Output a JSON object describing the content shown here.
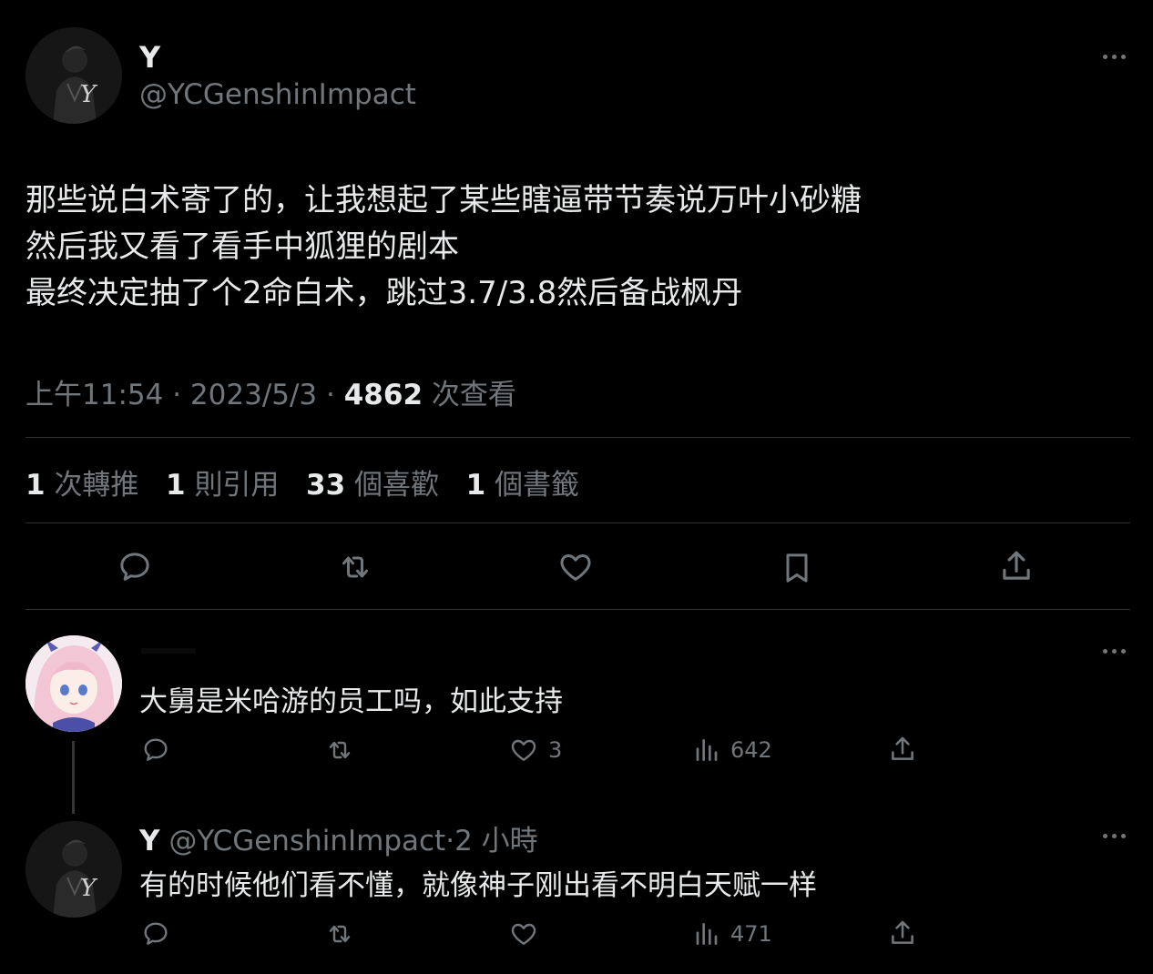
{
  "main_tweet": {
    "author_name": "Y",
    "author_handle": "@YCGenshinImpact",
    "avatar_letter": "Y",
    "lines": [
      "那些说白术寄了的，让我想起了某些瞎逼带节奏说万叶小砂糖",
      "然后我又看了看手中狐狸的剧本",
      "最终决定抽了个2命白术，跳过3.7/3.8然后备战枫丹"
    ],
    "time": "上午11:54",
    "date": "2023/5/3",
    "views": "4862",
    "views_label": "次查看",
    "sep": "·"
  },
  "engagement": {
    "retweets": "1",
    "retweets_label": "次轉推",
    "quotes": "1",
    "quotes_label": "則引用",
    "likes": "33",
    "likes_label": "個喜歡",
    "bookmarks": "1",
    "bookmarks_label": "個書籤"
  },
  "replies": [
    {
      "text": "大舅是米哈游的员工吗，如此支持",
      "likes": "3",
      "views": "642"
    },
    {
      "author_name": "Y",
      "author_handle": "@YCGenshinImpact",
      "time": "2 小時",
      "sep": "·",
      "avatar_letter": "Y",
      "text": "有的时候他们看不懂，就像神子刚出看不明白天赋一样",
      "views": "471"
    }
  ],
  "icons": {
    "more": "more-horizontal-icon",
    "reply": "reply-icon",
    "retweet": "retweet-icon",
    "like": "heart-icon",
    "bookmark": "bookmark-icon",
    "share": "share-icon",
    "views": "analytics-icon"
  },
  "colors": {
    "background": "#000000",
    "text": "#e7e9ea",
    "muted": "#71767b",
    "divider": "#2f3336"
  }
}
